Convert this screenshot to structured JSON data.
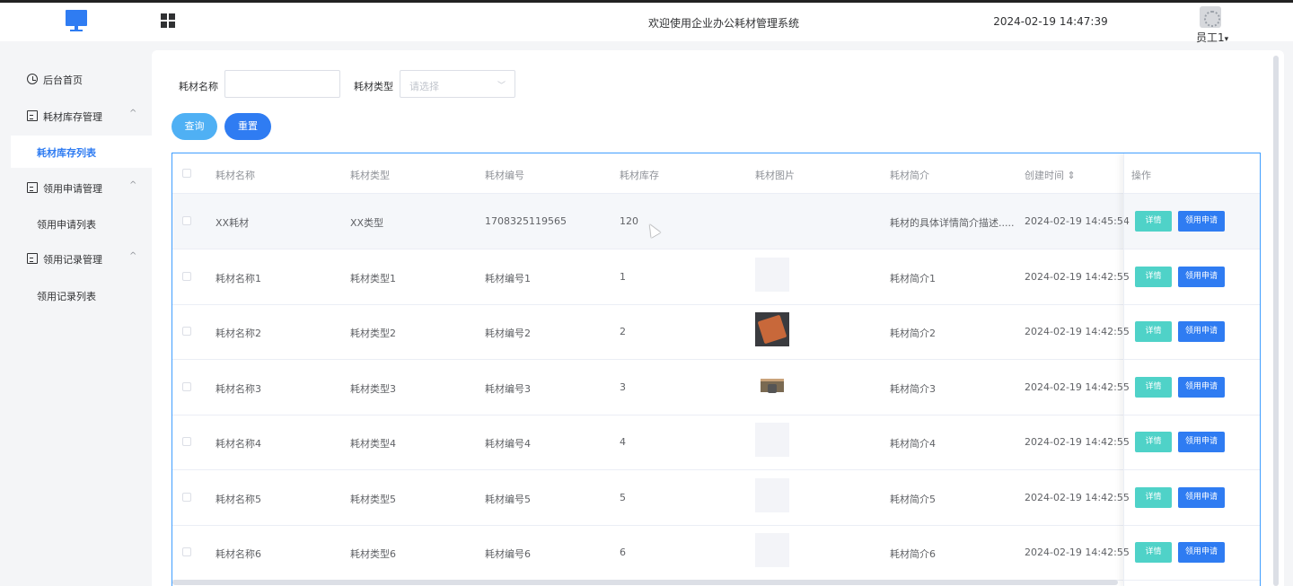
{
  "header": {
    "title": "欢迎使用企业办公耗材管理系统",
    "datetime": "2024-02-19 14:47:39",
    "user_name": "员工1",
    "user_caret": "▾"
  },
  "sidebar": {
    "home": "后台首页",
    "groups": [
      {
        "label": "耗材库存管理",
        "chevron": "^",
        "sub": "耗材库存列表"
      },
      {
        "label": "领用申请管理",
        "chevron": "^",
        "sub": "领用申请列表"
      },
      {
        "label": "领用记录管理",
        "chevron": "^",
        "sub": "领用记录列表"
      }
    ]
  },
  "filter": {
    "name_label": "耗材名称",
    "name_value": "",
    "type_label": "耗材类型",
    "type_placeholder": "请选择",
    "query_button": "查询",
    "reset_button": "重置"
  },
  "table": {
    "columns": [
      "耗材名称",
      "耗材类型",
      "耗材编号",
      "耗材库存",
      "耗材图片",
      "耗材简介",
      "创建时间",
      "操作"
    ],
    "sort_icon": "⇕",
    "detail_button": "详情",
    "apply_button": "领用申请",
    "rows": [
      {
        "name": "XX耗材",
        "type": "XX类型",
        "code": "1708325119565",
        "stock": "120",
        "image": "none",
        "intro": "耗材的具体详情简介描述.....",
        "created": "2024-02-19 14:45:54"
      },
      {
        "name": "耗材名称1",
        "type": "耗材类型1",
        "code": "耗材编号1",
        "stock": "1",
        "image": "placeholder",
        "intro": "耗材简介1",
        "created": "2024-02-19 14:42:55"
      },
      {
        "name": "耗材名称2",
        "type": "耗材类型2",
        "code": "耗材编号2",
        "stock": "2",
        "image": "notebook-photo",
        "intro": "耗材简介2",
        "created": "2024-02-19 14:42:55"
      },
      {
        "name": "耗材名称3",
        "type": "耗材类型3",
        "code": "耗材编号3",
        "stock": "3",
        "image": "desk-photo",
        "intro": "耗材简介3",
        "created": "2024-02-19 14:42:55"
      },
      {
        "name": "耗材名称4",
        "type": "耗材类型4",
        "code": "耗材编号4",
        "stock": "4",
        "image": "placeholder",
        "intro": "耗材简介4",
        "created": "2024-02-19 14:42:55"
      },
      {
        "name": "耗材名称5",
        "type": "耗材类型5",
        "code": "耗材编号5",
        "stock": "5",
        "image": "placeholder",
        "intro": "耗材简介5",
        "created": "2024-02-19 14:42:55"
      },
      {
        "name": "耗材名称6",
        "type": "耗材类型6",
        "code": "耗材编号6",
        "stock": "6",
        "image": "placeholder",
        "intro": "耗材简介6",
        "created": "2024-02-19 14:42:55"
      }
    ]
  },
  "colors": {
    "primary": "#2f7cf2",
    "query": "#4fb0f4",
    "detail": "#4fd2c8",
    "table_border": "#409eff"
  }
}
